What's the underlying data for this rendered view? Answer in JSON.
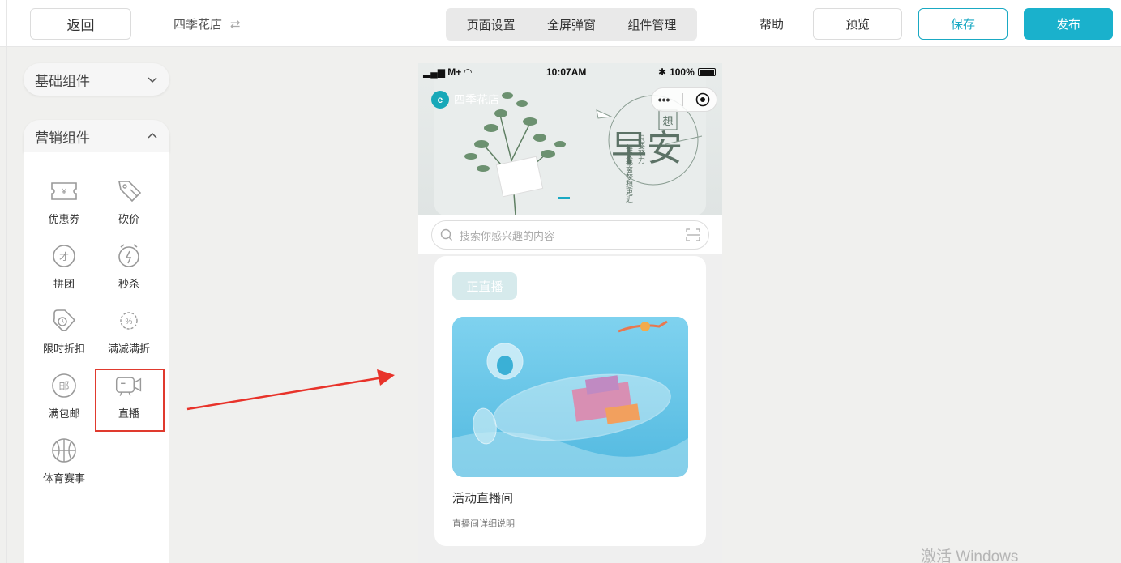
{
  "toolbar": {
    "back_label": "返回",
    "store_name": "四季花店",
    "segments": [
      "页面设置",
      "全屏弹窗",
      "组件管理"
    ],
    "help_label": "帮助",
    "preview_label": "预览",
    "save_label": "保存",
    "publish_label": "发布",
    "accent_color": "#1ab1cc"
  },
  "sidebar": {
    "basic_title": "基础组件",
    "marketing_title": "营销组件",
    "components": [
      {
        "label": "优惠券",
        "icon": "coupon-icon"
      },
      {
        "label": "砍价",
        "icon": "bargain-icon"
      },
      {
        "label": "拼团",
        "icon": "group-buy-icon"
      },
      {
        "label": "秒杀",
        "icon": "flash-sale-icon"
      },
      {
        "label": "限时折扣",
        "icon": "timed-discount-icon"
      },
      {
        "label": "满减满折",
        "icon": "full-reduction-icon"
      },
      {
        "label": "满包邮",
        "icon": "free-shipping-icon"
      },
      {
        "label": "直播",
        "icon": "live-icon"
      },
      {
        "label": "体育赛事",
        "icon": "sports-icon"
      }
    ],
    "highlight_color": "#e03a2e"
  },
  "phone": {
    "carrier": "M+",
    "time": "10:07AM",
    "battery": "100%",
    "nav_title": "四季花店",
    "banner": {
      "title_big": "早安",
      "title_small": "想",
      "vertical_lines": [
        "只要努力",
        "每天都离梦想更近"
      ]
    },
    "search_placeholder": "搜索你感兴趣的内容",
    "live": {
      "tag": "正直播",
      "title": "活动直播间",
      "description": "直播间详细说明"
    }
  },
  "watermark": "激活 Windows"
}
